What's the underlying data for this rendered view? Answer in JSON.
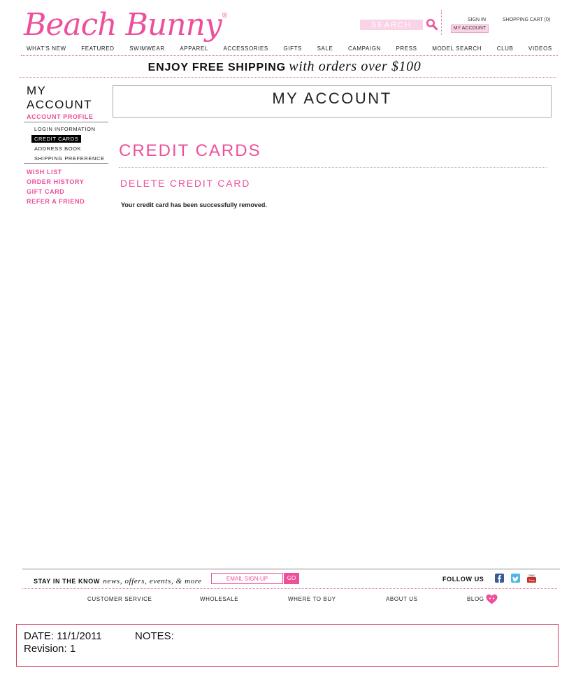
{
  "header": {
    "logo_text": "Beach Bunny",
    "logo_mark": "®",
    "search_placeholder": "SEARCH",
    "sign_in": "SIGN IN",
    "shopping_cart": "SHOPPING CART (0)",
    "my_account": "MY ACCOUNT"
  },
  "nav": {
    "items": [
      "WHAT'S NEW",
      "FEATURED",
      "SWIMWEAR",
      "APPAREL",
      "ACCESSORIES",
      "GIFTS",
      "SALE",
      "CAMPAIGN",
      "PRESS",
      "MODEL SEARCH",
      "CLUB",
      "VIDEOS"
    ]
  },
  "promo": {
    "bold": "ENJOY FREE SHIPPING",
    "italic": "with orders over $100"
  },
  "sidebar": {
    "title_line1": "MY",
    "title_line2": "ACCOUNT",
    "profile": "ACCOUNT PROFILE",
    "sub_items": [
      "LOGIN INFORMATION",
      "CREDIT CARDS",
      "ADDRESS BOOK",
      "SHIPPING PREFERENCE"
    ],
    "links": [
      "WISH LIST",
      "ORDER HISTORY",
      "GIFT CARD",
      "REFER A FRIEND"
    ]
  },
  "main": {
    "title": "MY ACCOUNT",
    "section_title": "CREDIT CARDS",
    "subsection_title": "DELETE CREDIT CARD",
    "message": "Your credit card has been successfully removed."
  },
  "footer": {
    "stay_bold": "STAY IN THE KNOW",
    "stay_italic": "news, offers, events, & more",
    "email_placeholder": "EMAIL SIGN-UP",
    "go": "GO",
    "follow_us": "FOLLOW US",
    "links": [
      "CUSTOMER SERVICE",
      "WHOLESALE",
      "WHERE TO BUY",
      "ABOUT US",
      "BLOG"
    ]
  },
  "notes": {
    "date": "DATE: 11/1/2011",
    "revision": "Revision: 1",
    "label": "NOTES:"
  },
  "colors": {
    "brand_pink": "#ee4f9b",
    "light_pink": "#fbd3e6",
    "notes_border": "#d23a5a"
  }
}
